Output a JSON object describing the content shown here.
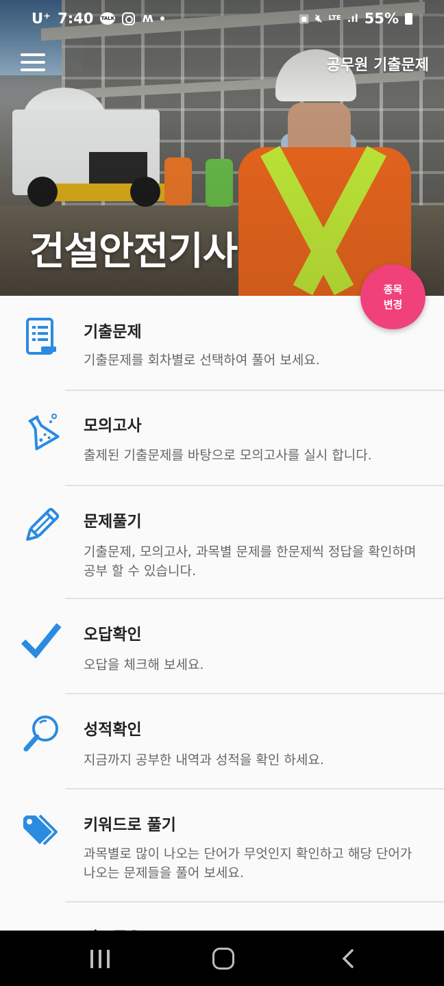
{
  "status_bar": {
    "carrier": "U⁺",
    "time": "7:40",
    "talk_badge": "TALK",
    "network": "LTE",
    "battery": "55%"
  },
  "app_bar": {
    "title": "공무원 기출문제"
  },
  "hero": {
    "title": "건설안전기사"
  },
  "fab": {
    "line1": "종목",
    "line2": "변경"
  },
  "menu_items": [
    {
      "icon": "notes-icon",
      "title": "기출문제",
      "desc": "기출문제를 회차별로 선택하여 풀어 보세요."
    },
    {
      "icon": "flask-icon",
      "title": "모의고사",
      "desc": "출제된 기출문제를 바탕으로 모의고사를 실시 합니다."
    },
    {
      "icon": "pencil-icon",
      "title": "문제풀기",
      "desc": "기출문제, 모의고사, 과목별 문제를 한문제씩 정답을 확인하며 공부 할 수 있습니다."
    },
    {
      "icon": "checkmark-icon",
      "title": "오답확인",
      "desc": "오답을 체크해 보세요."
    },
    {
      "icon": "magnifier-icon",
      "title": "성적확인",
      "desc": "지금까지 공부한 내역과 성적을 확인 하세요."
    },
    {
      "icon": "tags-icon",
      "title": "키워드로 풀기",
      "desc": "과목별로 많이 나오는 단어가 무엇인지 확인하고 해당 단어가 나오는 문제들을 풀어 보세요."
    },
    {
      "icon": "partial-icon",
      "title": "정보공유",
      "desc": ""
    }
  ],
  "colors": {
    "accent_blue": "#2b8be0",
    "fab_pink": "#f0417a",
    "title_text": "#222222",
    "desc_text": "#666666"
  }
}
